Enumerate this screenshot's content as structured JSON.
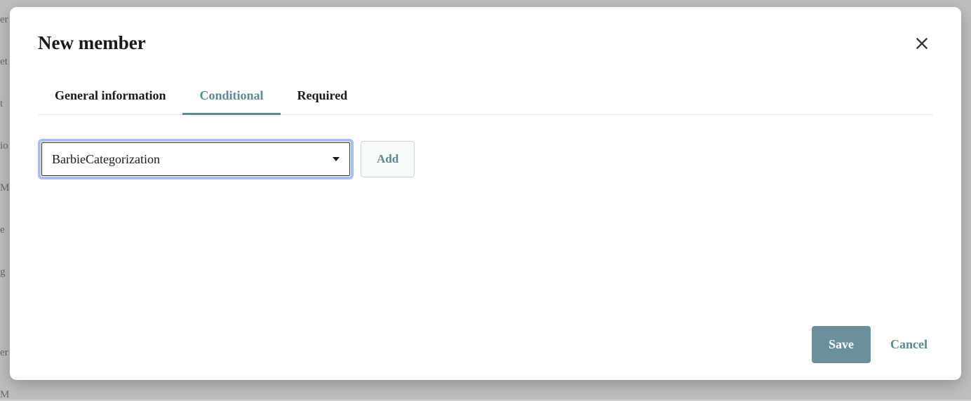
{
  "modal": {
    "title": "New member",
    "tabs": [
      {
        "label": "General information",
        "active": false
      },
      {
        "label": "Conditional",
        "active": true
      },
      {
        "label": "Required",
        "active": false
      }
    ],
    "conditional": {
      "select_value": "BarbieCategorization",
      "add_label": "Add"
    },
    "footer": {
      "save_label": "Save",
      "cancel_label": "Cancel"
    }
  }
}
